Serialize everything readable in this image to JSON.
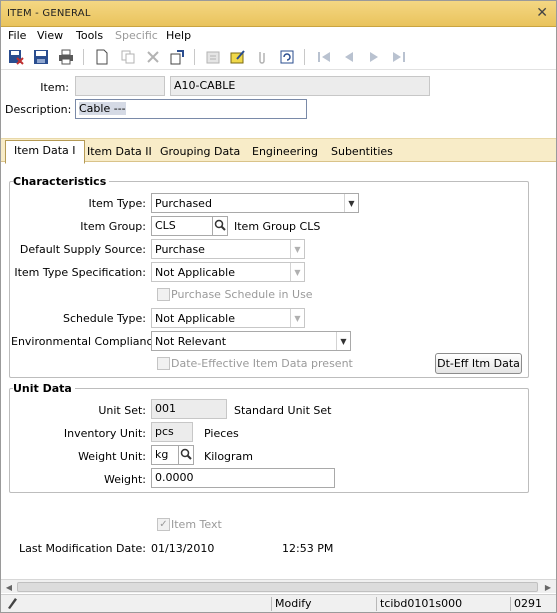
{
  "window": {
    "title": "ITEM - GENERAL",
    "close_glyph": "✕"
  },
  "menu": [
    {
      "label": "File",
      "enabled": true
    },
    {
      "label": "View",
      "enabled": true
    },
    {
      "label": "Tools",
      "enabled": true
    },
    {
      "label": "Specific",
      "enabled": false
    },
    {
      "label": "Help",
      "enabled": true
    }
  ],
  "header": {
    "item_label": "Item:",
    "item_prefix_value": "",
    "item_value": "A10-CABLE",
    "description_label": "Description:",
    "description_value": "Cable ---"
  },
  "tabs": [
    "Item Data I",
    "Item Data II",
    "Grouping Data",
    "Engineering",
    "Subentities"
  ],
  "characteristics": {
    "title": "Characteristics",
    "item_type_label": "Item Type:",
    "item_type_value": "Purchased",
    "item_group_label": "Item Group:",
    "item_group_value": "CLS",
    "item_group_desc": "Item Group CLS",
    "supply_source_label": "Default Supply Source:",
    "supply_source_value": "Purchase",
    "type_spec_label": "Item Type Specification:",
    "type_spec_value": "Not Applicable",
    "purchase_schedule_label": "Purchase Schedule in Use",
    "schedule_type_label": "Schedule Type:",
    "schedule_type_value": "Not Applicable",
    "env_compliance_label": "Environmental Compliance:",
    "env_compliance_value": "Not Relevant",
    "date_effective_label": "Date-Effective Item Data present",
    "dt_eff_button": "Dt-Eff Itm Data"
  },
  "unit_data": {
    "title": "Unit Data",
    "unit_set_label": "Unit Set:",
    "unit_set_value": "001",
    "unit_set_desc": "Standard Unit Set",
    "inventory_unit_label": "Inventory Unit:",
    "inventory_unit_value": "pcs",
    "inventory_unit_desc": "Pieces",
    "weight_unit_label": "Weight Unit:",
    "weight_unit_value": "kg",
    "weight_unit_desc": "Kilogram",
    "weight_label": "Weight:",
    "weight_value": "0.0000"
  },
  "footer": {
    "item_text_label": "Item Text",
    "last_mod_label": "Last Modification Date:",
    "last_mod_date": "01/13/2010",
    "last_mod_time": "12:53 PM"
  },
  "statusbar": {
    "mode": "Modify",
    "session": "tcibd0101s000",
    "company": "0291"
  },
  "colors": {
    "titlebar": "#f1d27a",
    "tabstrip": "#f8ecc8",
    "icon": "#1f3f78"
  }
}
